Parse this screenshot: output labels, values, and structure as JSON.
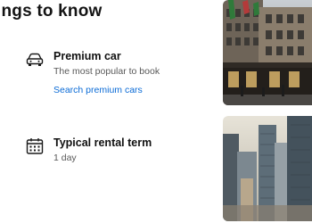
{
  "section": {
    "heading": "ings to know"
  },
  "items": [
    {
      "icon": "car-icon",
      "title": "Premium car",
      "subtitle": "The most popular to book",
      "link": "Search premium cars"
    },
    {
      "icon": "calendar-icon",
      "title": "Typical rental term",
      "subtitle": "1 day"
    }
  ],
  "images": [
    {
      "subject": "city-storefront-photo"
    },
    {
      "subject": "city-skyline-photo"
    }
  ],
  "colors": {
    "link": "#0b6bd6",
    "text": "#111111",
    "muted": "#595959"
  }
}
